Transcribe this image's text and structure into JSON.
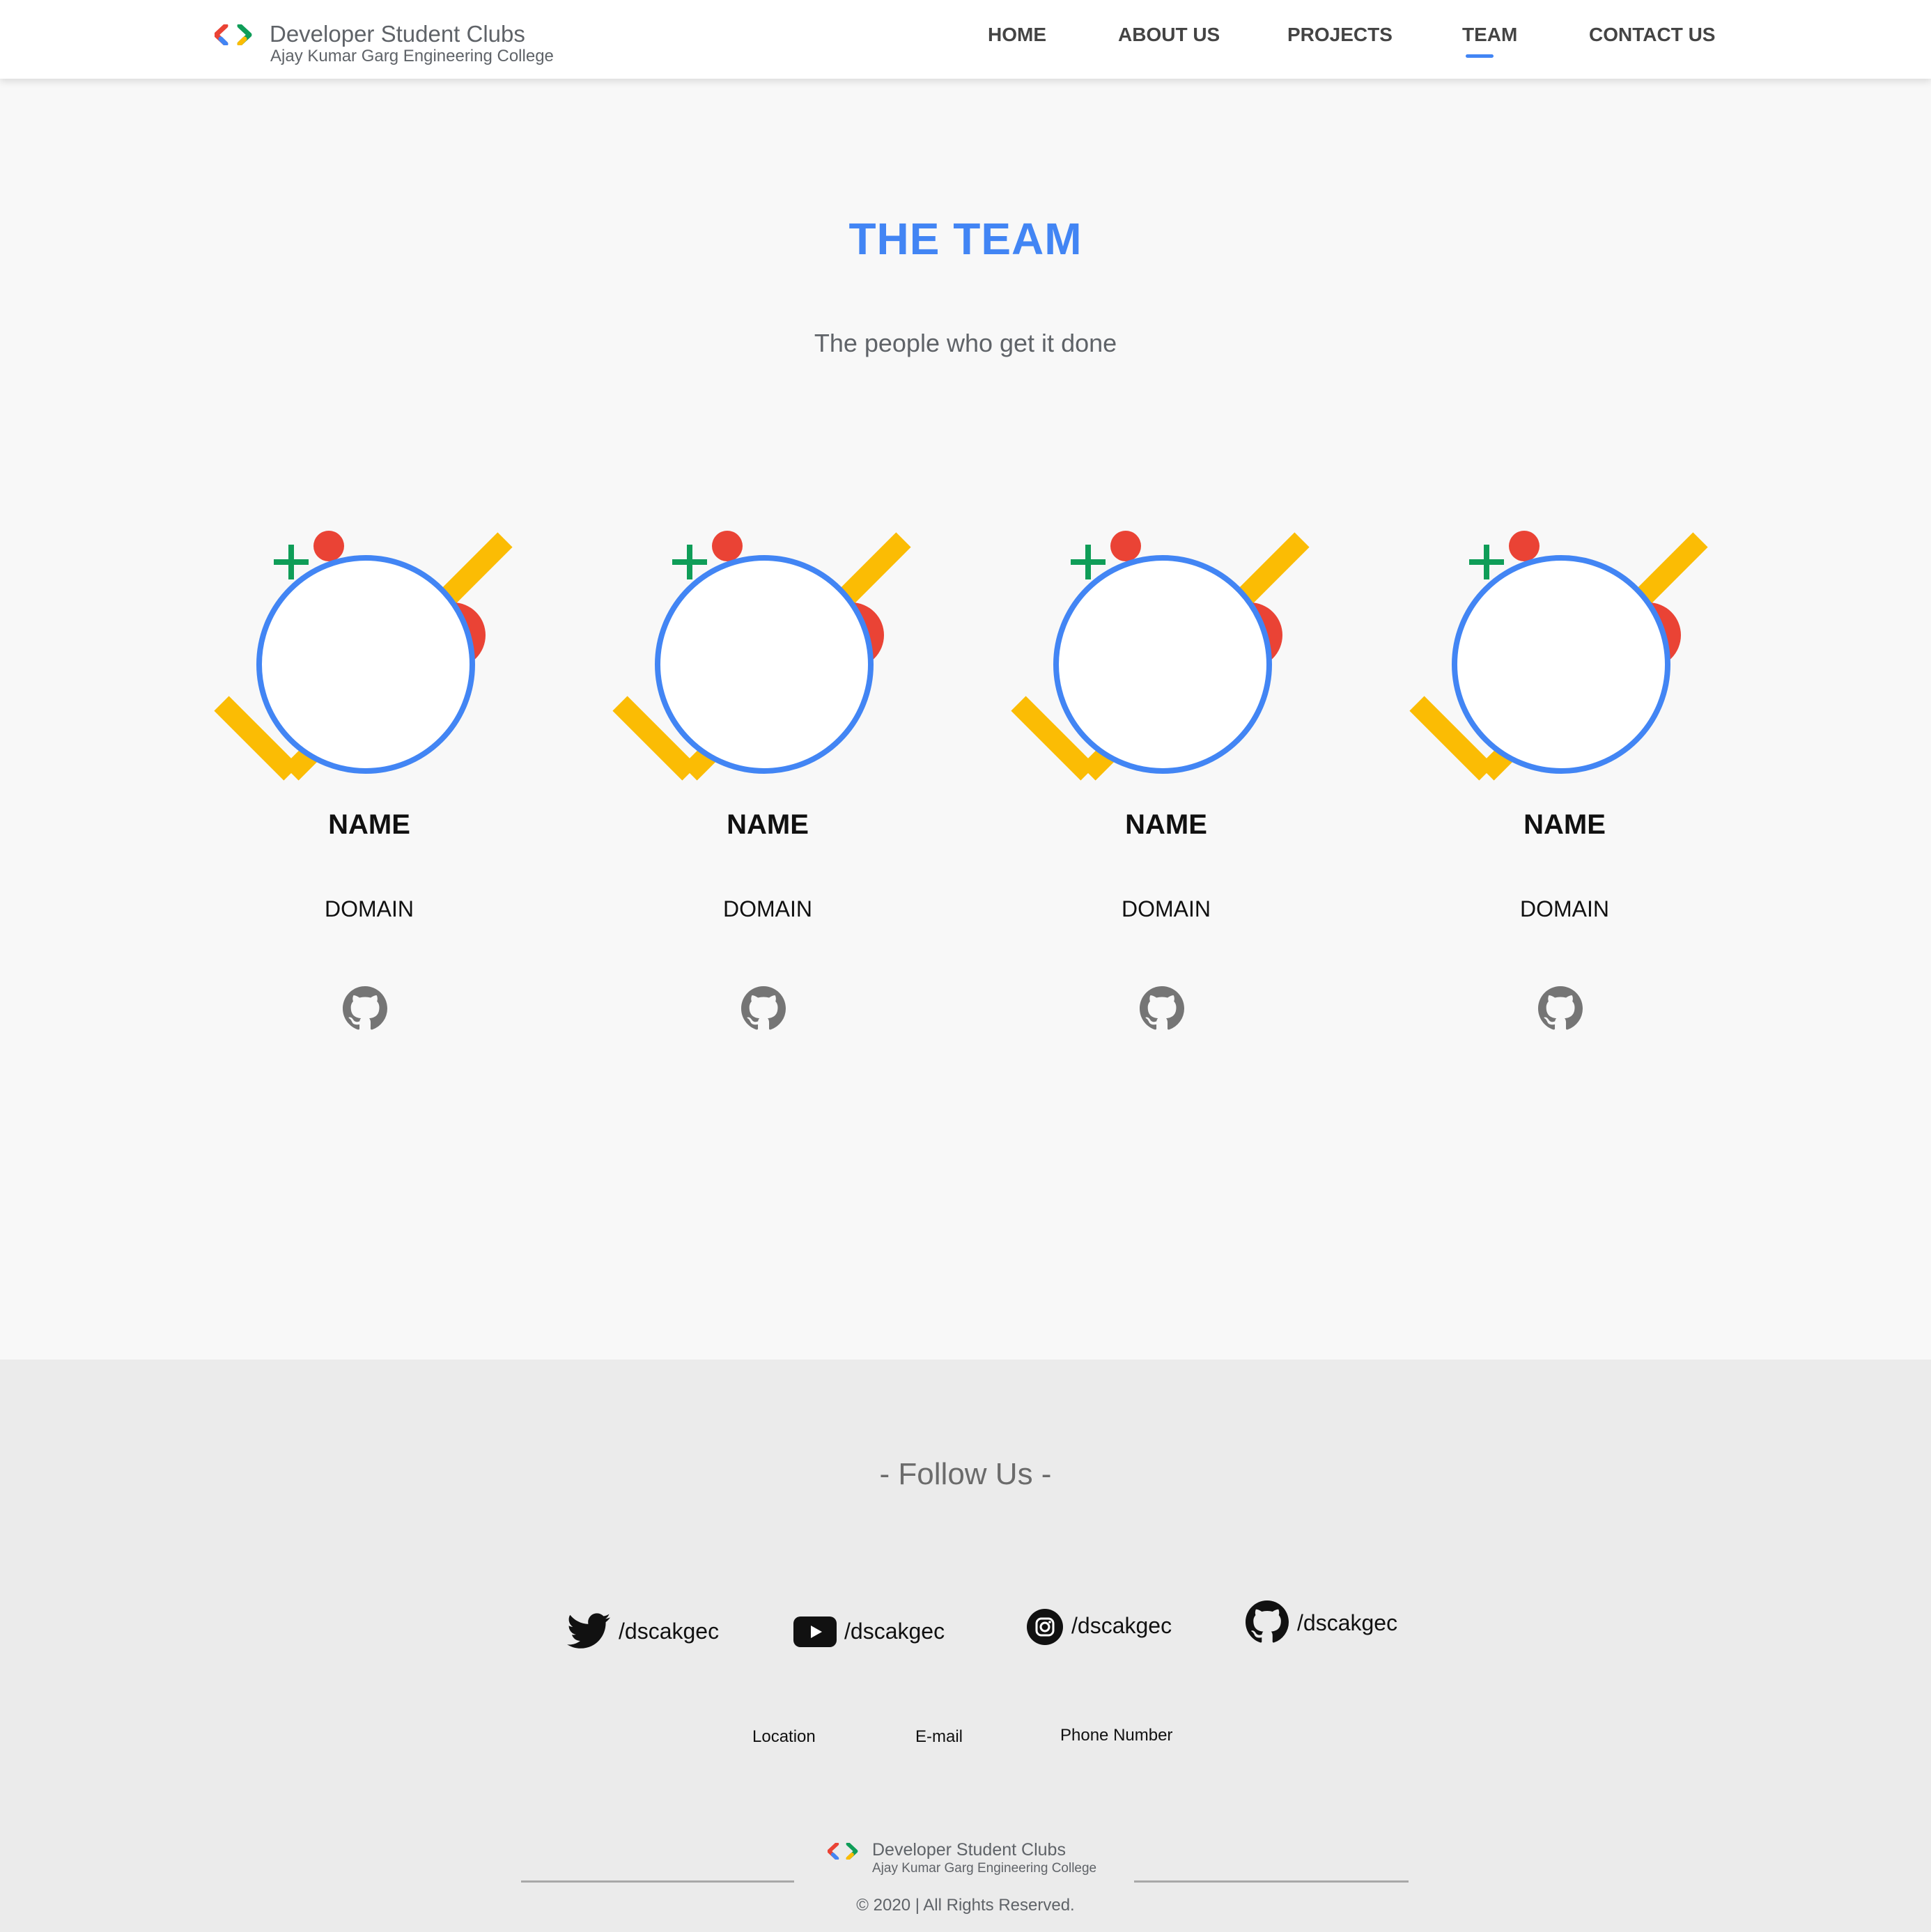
{
  "header": {
    "brand_title": "Developer Student Clubs",
    "brand_subtitle": "Ajay Kumar Garg Engineering College",
    "nav": [
      {
        "label": "HOME"
      },
      {
        "label": "ABOUT US"
      },
      {
        "label": "PROJECTS"
      },
      {
        "label": "TEAM",
        "active": true
      },
      {
        "label": "CONTACT US"
      }
    ]
  },
  "team": {
    "title": "THE TEAM",
    "subtitle": "The people who get it done",
    "members": [
      {
        "name": "NAME",
        "domain": "DOMAIN",
        "link_icon": "github-icon"
      },
      {
        "name": "NAME",
        "domain": "DOMAIN",
        "link_icon": "github-icon"
      },
      {
        "name": "NAME",
        "domain": "DOMAIN",
        "link_icon": "github-icon"
      },
      {
        "name": "NAME",
        "domain": "DOMAIN",
        "link_icon": "github-icon"
      }
    ]
  },
  "footer": {
    "follow_heading": "- Follow Us -",
    "socials": [
      {
        "icon": "twitter-icon",
        "handle": "/dscakgec"
      },
      {
        "icon": "youtube-icon",
        "handle": "/dscakgec"
      },
      {
        "icon": "instagram-icon",
        "handle": "/dscakgec"
      },
      {
        "icon": "github-icon",
        "handle": "/dscakgec"
      }
    ],
    "contact": {
      "location": "Location",
      "email": "E-mail",
      "phone": "Phone Number"
    },
    "brand_title": "Developer Student Clubs",
    "brand_subtitle": "Ajay Kumar Garg Engineering College",
    "copyright": "© 2020 | All Rights Reserved."
  },
  "colors": {
    "blue": "#4285f4",
    "red": "#ea4335",
    "yellow": "#fbbc04",
    "green": "#0f9d58",
    "background": "#f8f8f8",
    "footer_background": "#ebebeb"
  }
}
